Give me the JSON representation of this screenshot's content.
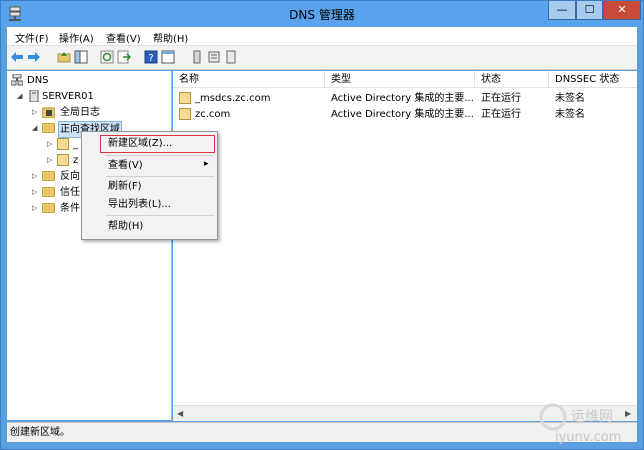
{
  "window": {
    "title": "DNS 管理器",
    "controls": {
      "minimize": "—",
      "maximize": "☐",
      "close": "✕"
    }
  },
  "menubar": [
    {
      "label": "文件(F)"
    },
    {
      "label": "操作(A)"
    },
    {
      "label": "查看(V)"
    },
    {
      "label": "帮助(H)"
    }
  ],
  "toolbar": [
    "back-arrow-icon",
    "forward-arrow-icon",
    "up-folder-icon",
    "show-hide-tree-icon",
    "refresh-icon",
    "export-list-icon",
    "help-icon",
    "properties-icon",
    "server-icon",
    "zone-icon",
    "record-icon"
  ],
  "tree": {
    "root": "DNS",
    "server": "SERVER01",
    "items": [
      {
        "label": "全局日志"
      },
      {
        "label": "正向查找区域"
      },
      {
        "label": "_"
      },
      {
        "label": "z"
      },
      {
        "label": "反向"
      },
      {
        "label": "信任"
      },
      {
        "label": "条件"
      }
    ]
  },
  "list": {
    "columns": [
      "名称",
      "类型",
      "状态",
      "DNSSEC 状态"
    ],
    "rows": [
      {
        "name": "_msdcs.zc.com",
        "type": "Active Directory 集成的主要...",
        "status": "正在运行",
        "dnssec": "未签名"
      },
      {
        "name": "zc.com",
        "type": "Active Directory 集成的主要...",
        "status": "正在运行",
        "dnssec": "未签名"
      }
    ]
  },
  "context_menu": {
    "items": [
      {
        "label": "新建区域(Z)..."
      },
      {
        "label": "查看(V)",
        "submenu_arrow": "▸"
      },
      {
        "label": "刷新(F)"
      },
      {
        "label": "导出列表(L)..."
      },
      {
        "label": "帮助(H)"
      }
    ]
  },
  "statusbar": {
    "text": "创建新区域。"
  },
  "watermark": {
    "name": "运维网",
    "url": "iyunv.com"
  },
  "colors": {
    "titlebar": "#58a3ec",
    "selection": "#cce4f7",
    "highlight_border": "#d9363e",
    "close_button": "#c74a3a"
  }
}
